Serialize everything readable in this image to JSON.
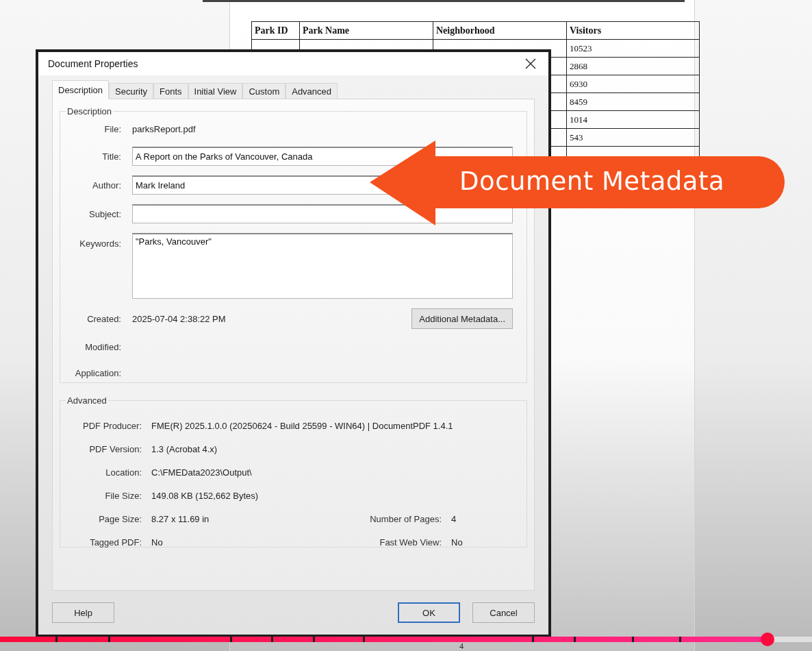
{
  "pdf_page": {
    "table": {
      "columns": [
        "Park ID",
        "Park Name",
        "Neighborhood",
        "Visitors"
      ],
      "rows": [
        {
          "visitors": "10523"
        },
        {
          "visitors": "2868"
        },
        {
          "visitors": "6930"
        },
        {
          "visitors": "8459"
        },
        {
          "visitors": "1014"
        },
        {
          "visitors": "543"
        },
        {}
      ]
    },
    "page_number": "4"
  },
  "dialog": {
    "title": "Document Properties",
    "tabs": [
      {
        "label": "Description",
        "selected": true
      },
      {
        "label": "Security",
        "selected": false
      },
      {
        "label": "Fonts",
        "selected": false
      },
      {
        "label": "Initial View",
        "selected": false
      },
      {
        "label": "Custom",
        "selected": false
      },
      {
        "label": "Advanced",
        "selected": false
      }
    ],
    "description_group": {
      "legend": "Description",
      "fields": [
        {
          "kind": "text",
          "label": "File:",
          "value": "parksReport.pdf"
        },
        {
          "kind": "input",
          "label": "Title:",
          "value": "A Report on the Parks of Vancouver, Canada"
        },
        {
          "kind": "input",
          "label": "Author:",
          "value": "Mark Ireland"
        },
        {
          "kind": "input",
          "label": "Subject:"
        },
        {
          "kind": "textarea",
          "label": "Keywords:",
          "value": "\"Parks, Vancouver\""
        },
        {
          "kind": "text",
          "label": "Created:",
          "value": "2025-07-04 2:38:22 PM",
          "button": "Additional Metadata..."
        },
        {
          "kind": "text",
          "label": "Modified:"
        },
        {
          "kind": "text",
          "label": "Application:"
        }
      ]
    },
    "advanced_group": {
      "legend": "Advanced",
      "rows": [
        {
          "label": "PDF Producer:",
          "value": "FME(R) 2025.1.0.0 (20250624 - Build 25599 - WIN64) | DocumentPDF 1.4.1"
        },
        {
          "label": "PDF Version:",
          "value": "1.3 (Acrobat 4.x)"
        },
        {
          "label": "Location:",
          "value": "C:\\FMEData2023\\Output\\"
        },
        {
          "label": "File Size:",
          "value": "149.08 KB (152,662 Bytes)"
        },
        {
          "label": "Page Size:",
          "value": "8.27 x 11.69 in",
          "label_2": "Number of Pages:",
          "value_2": "4"
        },
        {
          "label": "Tagged PDF:",
          "value": "No",
          "label_2": "Fast Web View:",
          "value_2": "No"
        }
      ]
    },
    "footer": {
      "left_buttons": [
        {
          "label": "Help",
          "default": false
        }
      ],
      "right_buttons": [
        {
          "label": "OK",
          "default": true
        },
        {
          "label": "Cancel",
          "default": false
        }
      ]
    }
  },
  "callout": {
    "text": "Document Metadata"
  },
  "player": {
    "level": 0.945
  }
}
